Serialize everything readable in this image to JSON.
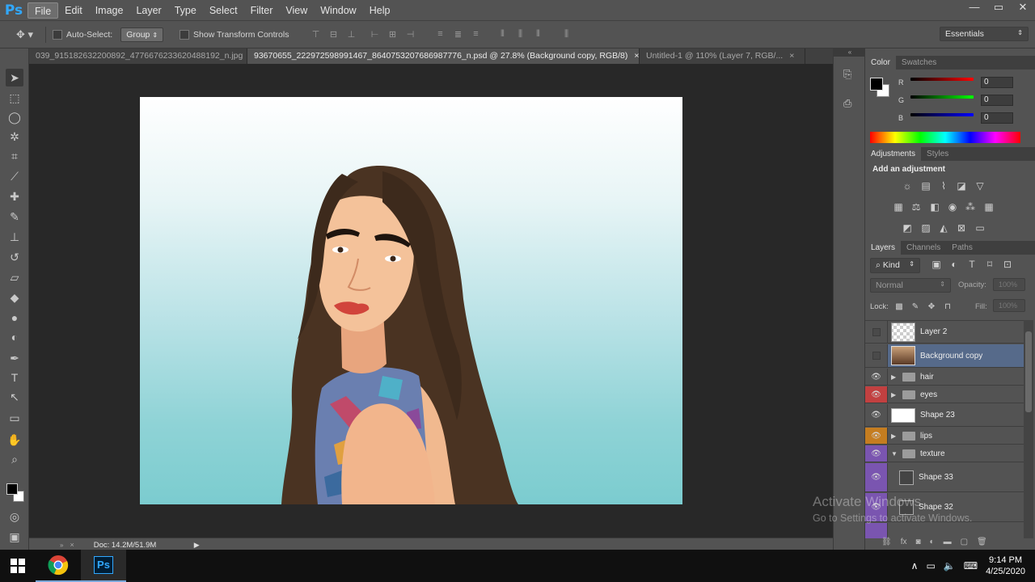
{
  "app": {
    "logo": "Ps"
  },
  "menu": [
    "File",
    "Edit",
    "Image",
    "Layer",
    "Type",
    "Select",
    "Filter",
    "View",
    "Window",
    "Help"
  ],
  "window_controls": {
    "minimize": "—",
    "restore": "▭",
    "close": "✕"
  },
  "options": {
    "auto_select_label": "Auto-Select:",
    "auto_select_value": "Group",
    "transform_label": "Show Transform Controls",
    "workspace": "Essentials"
  },
  "tabs": [
    {
      "label": "039_915182632200892_477667623362048819​2_n.jpg",
      "close": "×"
    },
    {
      "label": "93670655_222972598991467_8640753207686987776_n.psd @ 27.8% (Background copy, RGB/8)",
      "close": "×"
    },
    {
      "label": "Untitled-1 @ 110% (Layer 7, RGB/...",
      "close": "×"
    }
  ],
  "status": {
    "doc": "Doc: 14.2M/51.9M"
  },
  "color_panel": {
    "tabs": [
      "Color",
      "Swatches"
    ],
    "rows": [
      {
        "label": "R",
        "value": "0"
      },
      {
        "label": "G",
        "value": "0"
      },
      {
        "label": "B",
        "value": "0"
      }
    ]
  },
  "adjustments_panel": {
    "tabs": [
      "Adjustments",
      "Styles"
    ],
    "heading": "Add an adjustment"
  },
  "layers_panel": {
    "tabs": [
      "Layers",
      "Channels",
      "Paths"
    ],
    "kind": "Kind",
    "blend_mode": "Normal",
    "opacity_label": "Opacity:",
    "opacity_value": "100%",
    "lock_label": "Lock:",
    "fill_label": "Fill:",
    "fill_value": "100%",
    "layers": [
      {
        "name": "Layer 2",
        "type": "layer",
        "visible": false,
        "tag": "none"
      },
      {
        "name": "Background copy",
        "type": "layer",
        "visible": false,
        "tag": "none",
        "selected": true
      },
      {
        "name": "hair",
        "type": "group",
        "visible": true,
        "tag": "none"
      },
      {
        "name": "eyes",
        "type": "group",
        "visible": true,
        "tag": "red"
      },
      {
        "name": "Shape 23",
        "type": "shape",
        "visible": true,
        "tag": "none"
      },
      {
        "name": "lips",
        "type": "group",
        "visible": true,
        "tag": "orange"
      },
      {
        "name": "texture",
        "type": "group-open",
        "visible": true,
        "tag": "violet"
      },
      {
        "name": "Shape 33",
        "type": "shape",
        "visible": true,
        "tag": "violet"
      },
      {
        "name": "Shape 32",
        "type": "shape",
        "visible": true,
        "tag": "violet"
      }
    ],
    "tag_colors": {
      "red": "#c24040",
      "orange": "#c57d20",
      "violet": "#7a55b0",
      "none": "#535353"
    }
  },
  "watermark": {
    "line1": "Activate Windows",
    "line2": "Go to Settings to activate Windows."
  },
  "taskbar": {
    "time": "9:14 PM",
    "date": "4/25/2020",
    "ps_label": "Ps"
  },
  "colors": {
    "ps_blue": "#31a8ff",
    "selected_layer": "#566a8a"
  }
}
